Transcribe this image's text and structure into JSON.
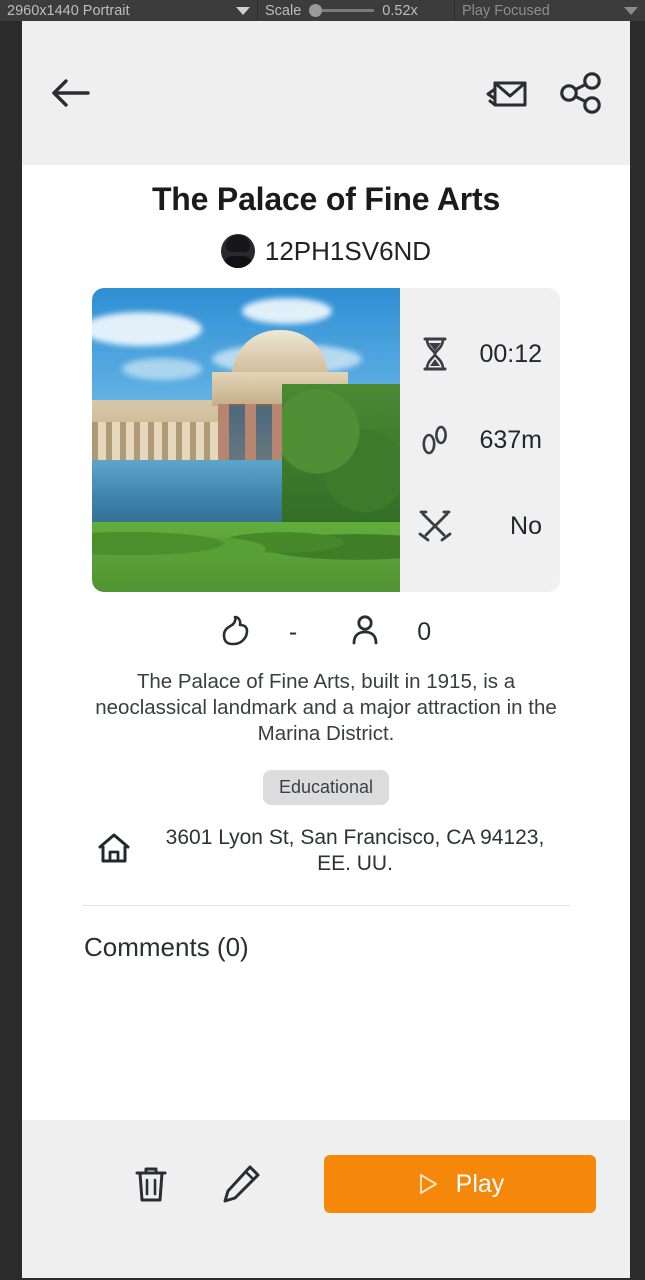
{
  "emulator": {
    "resolution": "2960x1440 Portrait",
    "scale_label": "Scale",
    "scale_value": "0.52x",
    "mode": "Play Focused"
  },
  "header": {
    "back_icon": "arrow-left-icon",
    "invite_icon": "envelope-invite-icon",
    "share_icon": "share-icon"
  },
  "detail": {
    "title": "The Palace of Fine Arts",
    "author": "12PH1SV6ND",
    "description": "The Palace of Fine Arts, built in 1915, is a neoclassical landmark and a major attraction in the Marina District.",
    "tag": "Educational",
    "address": "3601 Lyon St, San Francisco, CA 94123, EE. UU.",
    "comments_heading": "Comments (0)"
  },
  "stats": [
    {
      "icon": "hourglass-icon",
      "value": "00:12"
    },
    {
      "icon": "footsteps-icon",
      "value": "637m"
    },
    {
      "icon": "crossed-swords-icon",
      "value": "No"
    }
  ],
  "reactions": [
    {
      "icon": "thumbs-up-icon",
      "value": "-"
    },
    {
      "icon": "person-icon",
      "value": "0"
    }
  ],
  "bottom_bar": {
    "delete_icon": "trash-icon",
    "edit_icon": "pencil-icon",
    "play_label": "Play",
    "play_icon": "play-triangle-icon"
  },
  "colors": {
    "accent_orange": "#f5880b",
    "header_gray": "#efefef",
    "panel_gray": "#f0f0f0",
    "tag_gray": "#dcdcdc",
    "text_dark": "#23262b"
  }
}
